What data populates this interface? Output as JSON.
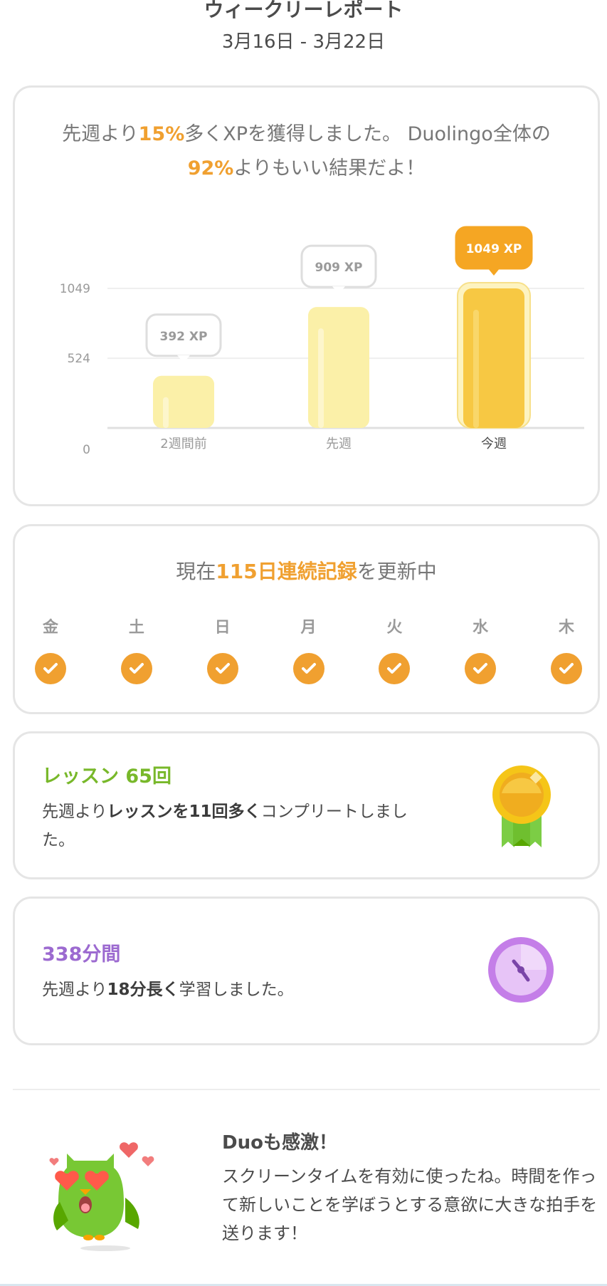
{
  "header": {
    "title": "ウィークリーレポート",
    "date_range": "3月16日 - 3月22日"
  },
  "xp_card": {
    "text_1": "先週より",
    "percent_more": "15%",
    "text_2": "多くXPを獲得しました。 Duolingo全体の",
    "percentile": "92%",
    "text_3": "よりもいい結果だよ！"
  },
  "chart_data": {
    "type": "bar",
    "categories": [
      "2週間前",
      "先週",
      "今週"
    ],
    "values": [
      392,
      909,
      1049
    ],
    "value_labels": [
      "392 XP",
      "909 XP",
      "1049 XP"
    ],
    "y_ticks": [
      "0",
      "524",
      "1049"
    ],
    "ylim": [
      0,
      1049
    ],
    "highlight_index": 2,
    "colors": {
      "bar": "#fbf0a8",
      "bar_highlight": "#f7c843",
      "badge_highlight": "#f5a623"
    }
  },
  "streak_card": {
    "prefix": "現在",
    "streak": "115日連続記録",
    "suffix": "を更新中",
    "days": [
      "金",
      "土",
      "日",
      "月",
      "火",
      "水",
      "木"
    ]
  },
  "lessons_card": {
    "title": "レッスン 65回",
    "desc_1": "先週より",
    "desc_bold": "レッスンを11回多く",
    "desc_2": "コンプリートしました。"
  },
  "time_card": {
    "title": "338分間",
    "desc_1": "先週より",
    "desc_bold": "18分長く",
    "desc_2": "学習しました。"
  },
  "duo": {
    "title": "Duoも感激！",
    "text": "スクリーンタイムを有効に使ったね。時間を作って新しいことを学ぼうとする意欲に大きな拍手を送ります！"
  },
  "colors": {
    "accent": "#f0a030",
    "lessons": "#78b82a",
    "time": "#9c6ad0",
    "checkmark_fill": "#f0a030"
  },
  "icons": {
    "lessons": "medal-icon",
    "time": "clock-icon",
    "check": "checkmark-icon",
    "mascot": "duo-owl-icon"
  }
}
